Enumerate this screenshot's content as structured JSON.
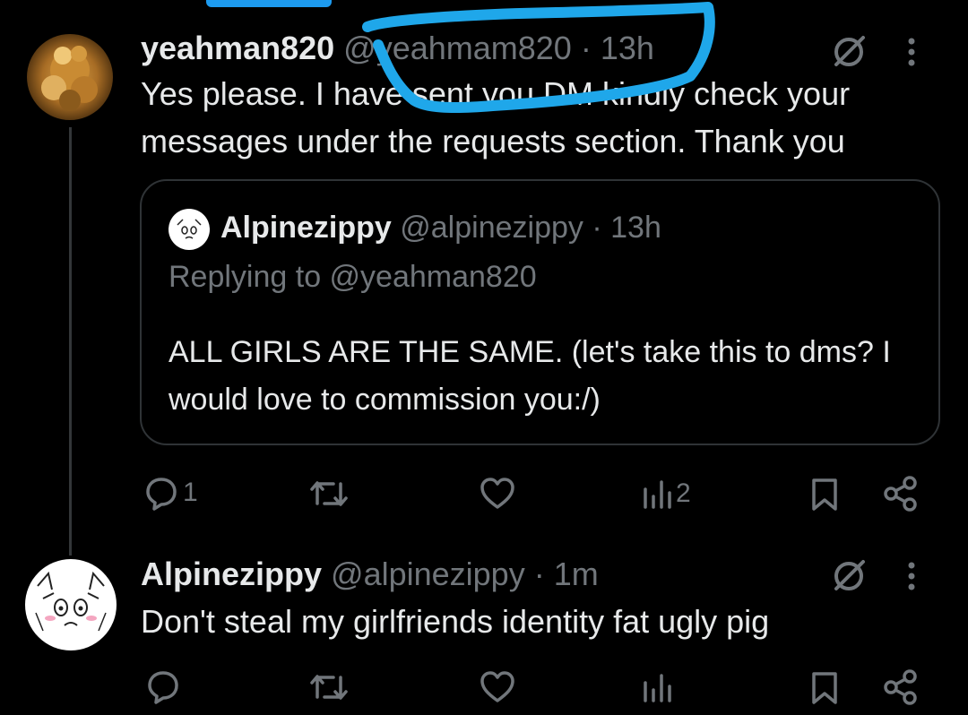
{
  "colors": {
    "background": "#000000",
    "text_primary": "#e7e9ea",
    "text_secondary": "#71767b",
    "border": "#2f3336",
    "accent": "#1d9bf0"
  },
  "tweets": [
    {
      "display_name": "yeahman820",
      "handle": "@yeahmam820",
      "time": "13h",
      "text": "Yes please. I have sent you DM kindly check your messages under the requests section. Thank you",
      "quote": {
        "display_name": "Alpinezippy",
        "handle": "@alpinezippy",
        "time": "13h",
        "replying_to": "Replying to @yeahman820",
        "text": "ALL GIRLS ARE THE SAME. (let's take this to dms? I would love to commission you:/)"
      },
      "actions": {
        "replies": "1",
        "reposts": "",
        "likes": "",
        "views": "2"
      }
    },
    {
      "display_name": "Alpinezippy",
      "handle": "@alpinezippy",
      "time": "1m",
      "text": "Don't steal my girlfriends identity fat ugly pig",
      "actions": {
        "replies": "",
        "reposts": "",
        "likes": "",
        "views": ""
      }
    }
  ],
  "separator": "·",
  "icons": {
    "grok_icon": "slashed-circle-icon",
    "more_icon": "vertical-ellipsis-icon",
    "reply_icon": "speech-bubble-icon",
    "repost_icon": "repost-arrows-icon",
    "like_icon": "heart-icon",
    "views_icon": "bar-chart-icon",
    "bookmark_icon": "bookmark-icon",
    "share_icon": "share-nodes-icon"
  }
}
